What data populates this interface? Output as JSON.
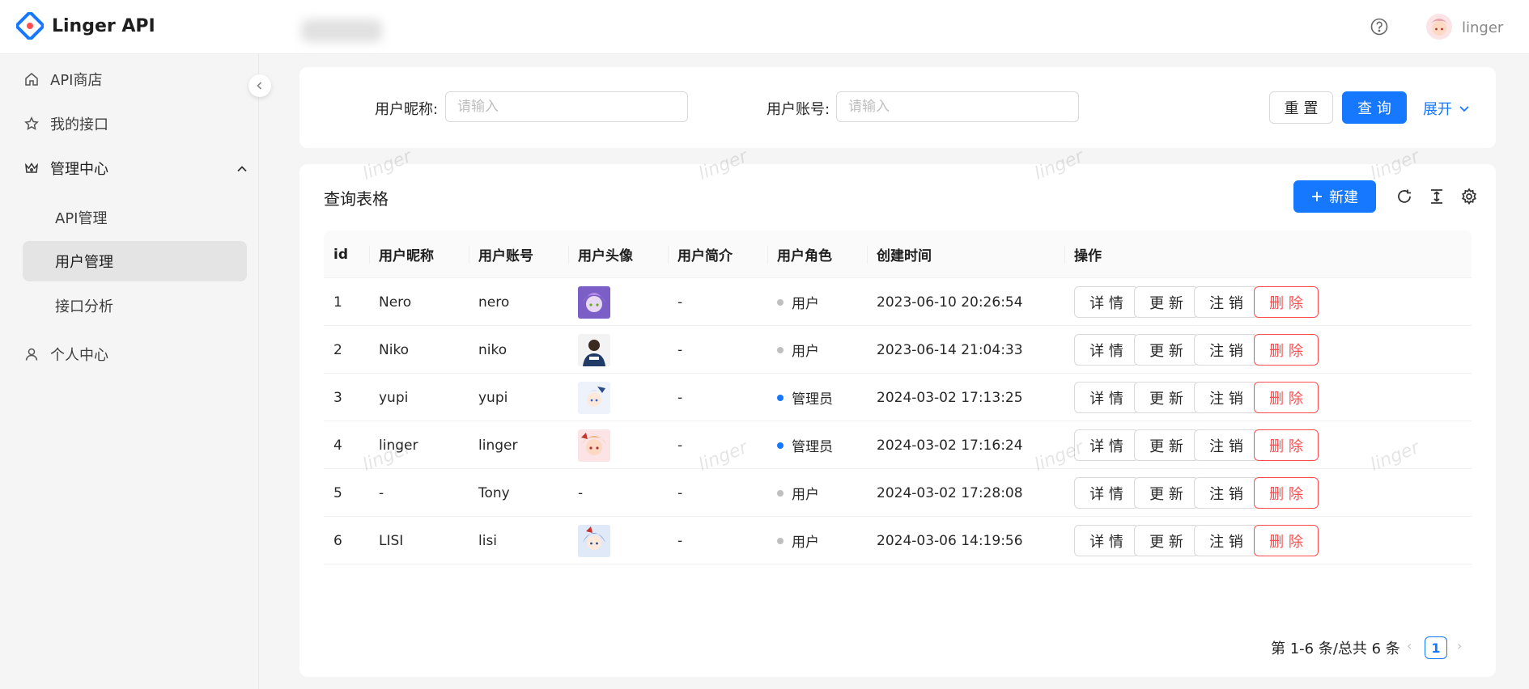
{
  "header": {
    "app_title": "Linger API",
    "user_name": "linger"
  },
  "sidebar": {
    "items": [
      {
        "label": "API商店",
        "icon": "home-icon"
      },
      {
        "label": "我的接口",
        "icon": "star-icon"
      },
      {
        "label": "管理中心",
        "icon": "crown-icon"
      },
      {
        "label": "个人中心",
        "icon": "user-icon"
      }
    ],
    "sub_items": [
      {
        "label": "API管理",
        "active": false
      },
      {
        "label": "用户管理",
        "active": true
      },
      {
        "label": "接口分析",
        "active": false
      }
    ]
  },
  "search": {
    "nickname_label": "用户昵称:",
    "nickname_placeholder": "请输入",
    "account_label": "用户账号:",
    "account_placeholder": "请输入",
    "reset_label": "重 置",
    "query_label": "查 询",
    "expand_label": "展开"
  },
  "table": {
    "title": "查询表格",
    "new_label": "新建",
    "columns": [
      "id",
      "用户昵称",
      "用户账号",
      "用户头像",
      "用户简介",
      "用户角色",
      "创建时间",
      "操作"
    ],
    "actions": [
      "详 情",
      "更 新",
      "注 销",
      "删 除"
    ],
    "rows": [
      {
        "id": "1",
        "nickname": "Nero",
        "account": "nero",
        "avatar": "purple",
        "profile": "-",
        "role": "用户",
        "role_color": "#bfbfbf",
        "created": "2023-06-10 20:26:54"
      },
      {
        "id": "2",
        "nickname": "Niko",
        "account": "niko",
        "avatar": "dark",
        "profile": "-",
        "role": "用户",
        "role_color": "#bfbfbf",
        "created": "2023-06-14 21:04:33"
      },
      {
        "id": "3",
        "nickname": "yupi",
        "account": "yupi",
        "avatar": "blue-white",
        "profile": "-",
        "role": "管理员",
        "role_color": "#1677ff",
        "created": "2024-03-02 17:13:25"
      },
      {
        "id": "4",
        "nickname": "linger",
        "account": "linger",
        "avatar": "pink",
        "profile": "-",
        "role": "管理员",
        "role_color": "#1677ff",
        "created": "2024-03-02 17:16:24"
      },
      {
        "id": "5",
        "nickname": "-",
        "account": "Tony",
        "avatar": "-",
        "profile": "-",
        "role": "用户",
        "role_color": "#bfbfbf",
        "created": "2024-03-02 17:28:08"
      },
      {
        "id": "6",
        "nickname": "LISI",
        "account": "lisi",
        "avatar": "blue",
        "profile": "-",
        "role": "用户",
        "role_color": "#bfbfbf",
        "created": "2024-03-06 14:19:56"
      }
    ]
  },
  "pagination": {
    "summary": "第 1-6 条/总共 6 条",
    "current_page": "1"
  },
  "watermark_text": "linger",
  "colors": {
    "primary": "#1677ff",
    "danger": "#ff4d4f"
  }
}
